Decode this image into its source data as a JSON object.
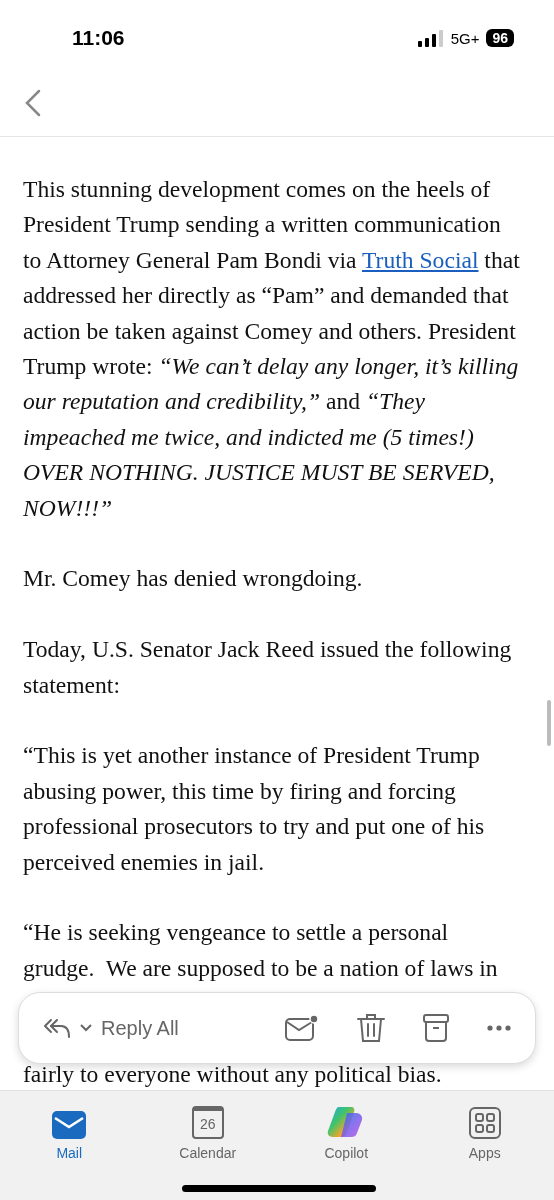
{
  "status_bar": {
    "time": "11:06",
    "network": "5G+",
    "battery": "96"
  },
  "body": {
    "paragraphs": [
      {
        "text": "This stunning development comes on the heels of President Trump sending a written communication to Attorney General Pam Bondi via ",
        "link": "Truth Social",
        "after": " that addressed her directly as “Pam” and demanded that action be taken against Comey and others. President Trump wrote: *“We can’t delay any longer, it’s killing our reputation and credibility,”* and *“They impeached me twice, and indicted me (5 times!) OVER NOTHING. JUSTICE MUST BE SERVED, NOW!!!”*"
      },
      {
        "text": "Mr. Comey has denied wrongdoing."
      },
      {
        "text": "Today, U.S. Senator Jack Reed issued the following statement:"
      },
      {
        "text": "“This is yet another instance of President Trump abusing power, this time by firing and forcing professional prosecutors to try and put one of his perceived enemies in jail."
      },
      {
        "text": "“He is seeking vengeance to settle a personal grudge.  We are supposed to be a nation of laws in"
      }
    ],
    "partial_line": "fairly to everyone without any political bias."
  },
  "action_bar": {
    "reply_label": "Reply All"
  },
  "tabs": [
    {
      "label": "Mail",
      "selected": true
    },
    {
      "label": "Calendar",
      "selected": false,
      "date": "26"
    },
    {
      "label": "Copilot",
      "selected": false
    },
    {
      "label": "Apps",
      "selected": false
    }
  ]
}
